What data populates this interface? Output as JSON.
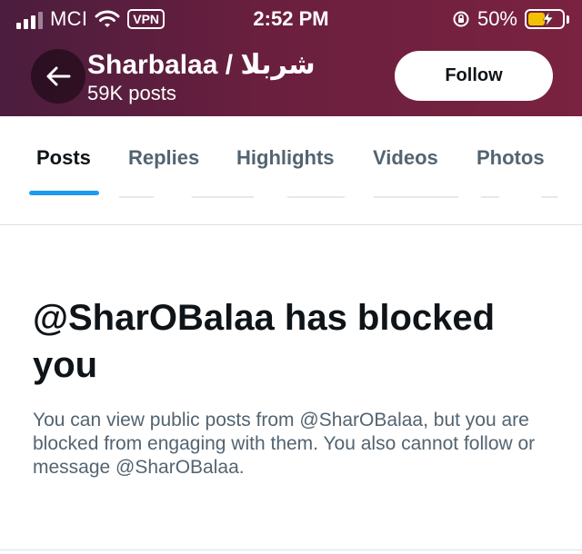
{
  "status_bar": {
    "carrier": "MCI",
    "vpn": "VPN",
    "time": "2:52 PM",
    "battery_percent": "50%",
    "battery_level": 0.5,
    "icons": [
      "signal-icon",
      "wifi-icon",
      "rotation-lock-icon",
      "battery-charging-icon"
    ]
  },
  "profile": {
    "name": "Sharbalaa / شربلا",
    "posts": "59K posts",
    "follow_label": "Follow"
  },
  "tabs": [
    {
      "label": "Posts",
      "active": true
    },
    {
      "label": "Replies",
      "active": false
    },
    {
      "label": "Highlights",
      "active": false
    },
    {
      "label": "Videos",
      "active": false
    },
    {
      "label": "Photos",
      "active": false
    }
  ],
  "blocked": {
    "title": "@SharOBalaa has blocked you",
    "description": "You can view public posts from @SharOBalaa, but you are blocked from engaging with them. You also cannot follow or message @SharOBalaa."
  },
  "colors": {
    "accent": "#1d9bf0",
    "header": "#6a1f3e",
    "battery": "#f2c200"
  }
}
